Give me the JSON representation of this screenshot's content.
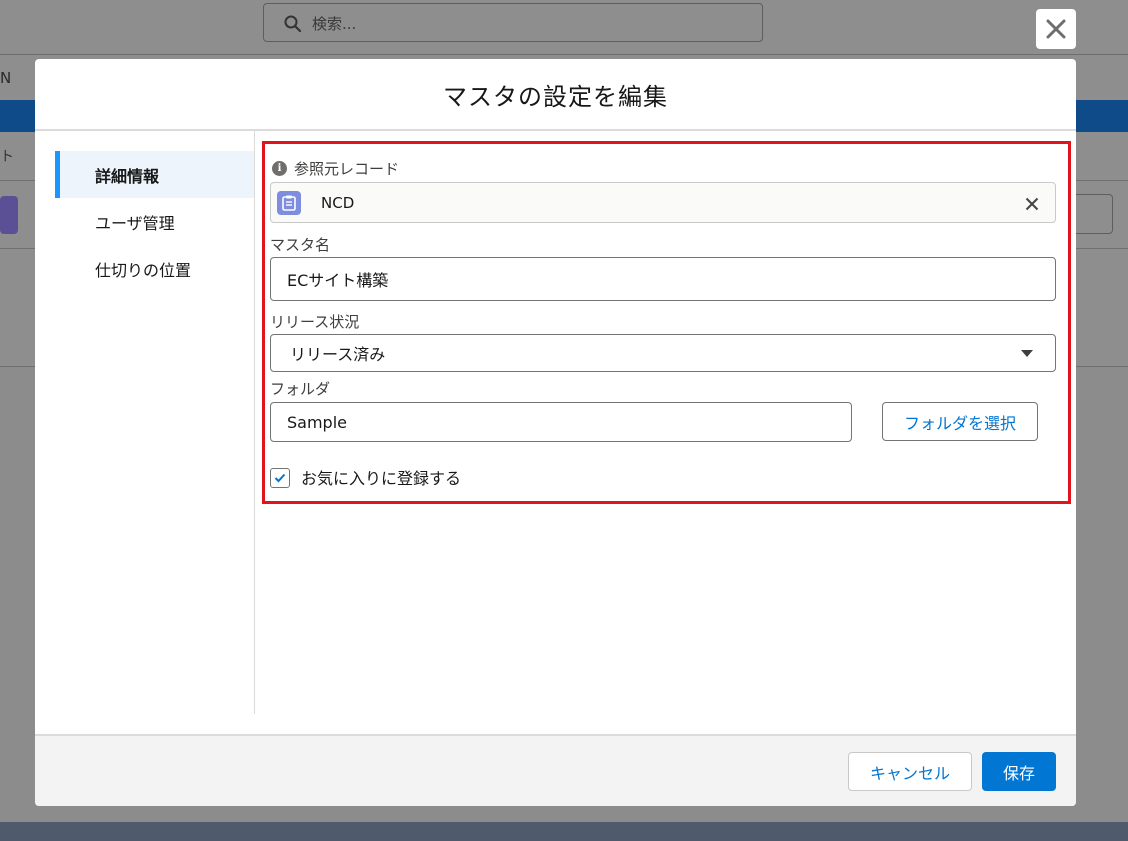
{
  "background": {
    "search_placeholder": "検索...",
    "nav_fragment": "N",
    "tab_fragment": "ト"
  },
  "modal": {
    "title": "マスタの設定を編集",
    "close_icon": "close-icon"
  },
  "sidebar": {
    "items": [
      {
        "label": "詳細情報",
        "active": true
      },
      {
        "label": "ユーザ管理",
        "active": false
      },
      {
        "label": "仕切りの位置",
        "active": false
      }
    ]
  },
  "form": {
    "reference": {
      "label": "参照元レコード",
      "value": "NCD"
    },
    "master_name": {
      "label": "マスタ名",
      "value": "ECサイト構築"
    },
    "release_status": {
      "label": "リリース状況",
      "value": "リリース済み"
    },
    "folder": {
      "label": "フォルダ",
      "value": "Sample",
      "select_button": "フォルダを選択"
    },
    "favorite": {
      "label": "お気に入りに登録する",
      "checked": true
    }
  },
  "footer": {
    "cancel_label": "キャンセル",
    "save_label": "保存"
  },
  "colors": {
    "brand": "#0176d3",
    "highlight": "#e1141e",
    "nav_active_bar": "#1b96ff",
    "object_icon": "#7f8de1"
  }
}
